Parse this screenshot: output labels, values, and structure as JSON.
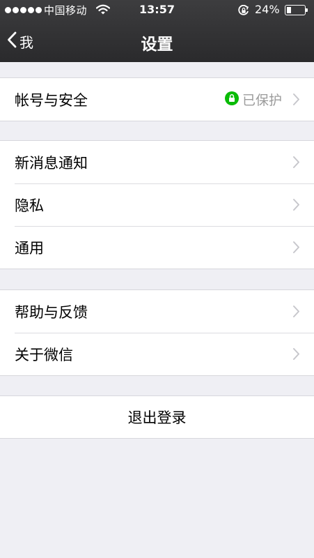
{
  "status_bar": {
    "signal_dots": 5,
    "carrier": "中国移动",
    "time": "13:57",
    "battery_percent": "24%",
    "battery_level": 0.24,
    "icons": [
      "wifi-icon",
      "rotation-lock-icon",
      "battery-icon"
    ]
  },
  "nav": {
    "back_label": "我",
    "title": "设置"
  },
  "groups": {
    "account": {
      "label": "帐号与安全",
      "status": "已保护",
      "status_icon": "lock-icon",
      "status_color": "#09bb07"
    },
    "notifications": {
      "label": "新消息通知"
    },
    "privacy": {
      "label": "隐私"
    },
    "general": {
      "label": "通用"
    },
    "help": {
      "label": "帮助与反馈"
    },
    "about": {
      "label": "关于微信"
    }
  },
  "logout": {
    "label": "退出登录"
  },
  "colors": {
    "nav_background": "#2f2f31",
    "page_background": "#efeff4",
    "chevron": "#c7c7cc",
    "secondary_text": "#9b9b9b"
  }
}
